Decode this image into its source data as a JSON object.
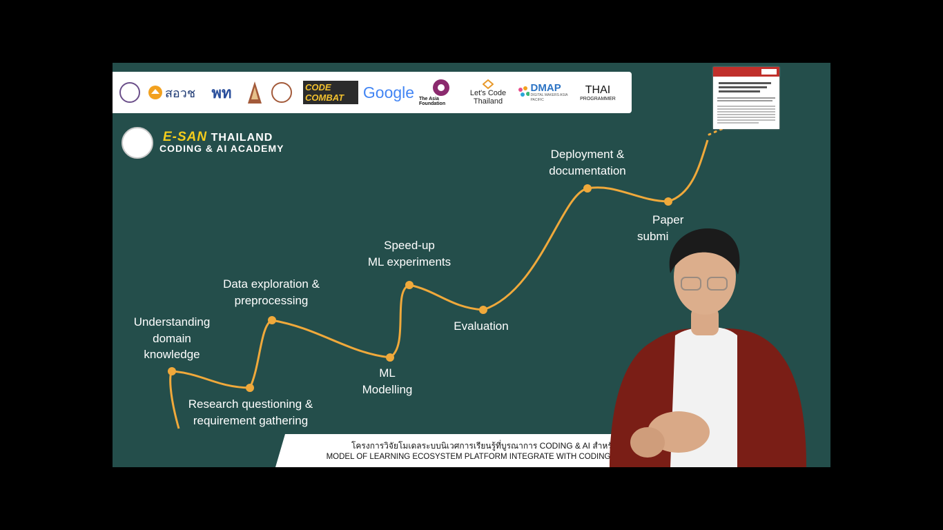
{
  "logos": {
    "sorwor": "สอวช",
    "pt": "พท",
    "codecombat": "CODE COMBAT",
    "google": "Google",
    "asia_foundation": "The Asia Foundation",
    "letscode_1": "Let's Code",
    "letscode_2": "Thailand",
    "dmap": "DMAP",
    "dmap_sub": "DIGITAL MAKERS ASIA PACIFIC",
    "thai_programmer": "THAI",
    "thai_programmer_sub": "PROGRAMMER"
  },
  "academy": {
    "esan": "E-SAN",
    "line1": "THAILAND",
    "line2": "CODING & AI ACADEMY"
  },
  "roadmap": {
    "steps": [
      {
        "line1": "Understanding",
        "line2": "domain",
        "line3": "knowledge"
      },
      {
        "line1": "Research questioning &",
        "line2": "requirement gathering"
      },
      {
        "line1": "Data exploration &",
        "line2": "preprocessing"
      },
      {
        "line1": "ML",
        "line2": "Modelling"
      },
      {
        "line1": "Speed-up",
        "line2": "ML experiments"
      },
      {
        "line1": "Evaluation"
      },
      {
        "line1": "Deployment &",
        "line2": "documentation"
      },
      {
        "line1": "Paper",
        "line2": "submi"
      }
    ],
    "accent": "#f0a93b"
  },
  "banner": {
    "thai": "โครงการวิจัยโมเดลระบบนิเวศการเรียนรู้ที่บูรณาการ CODING & AI สำหรับเยาว",
    "english": "MODEL OF LEARNING ECOSYSTEM PLATFORM INTEGRATE WITH CODING & AI F"
  },
  "colors": {
    "background": "#244e4b",
    "path": "#f0a93b"
  }
}
